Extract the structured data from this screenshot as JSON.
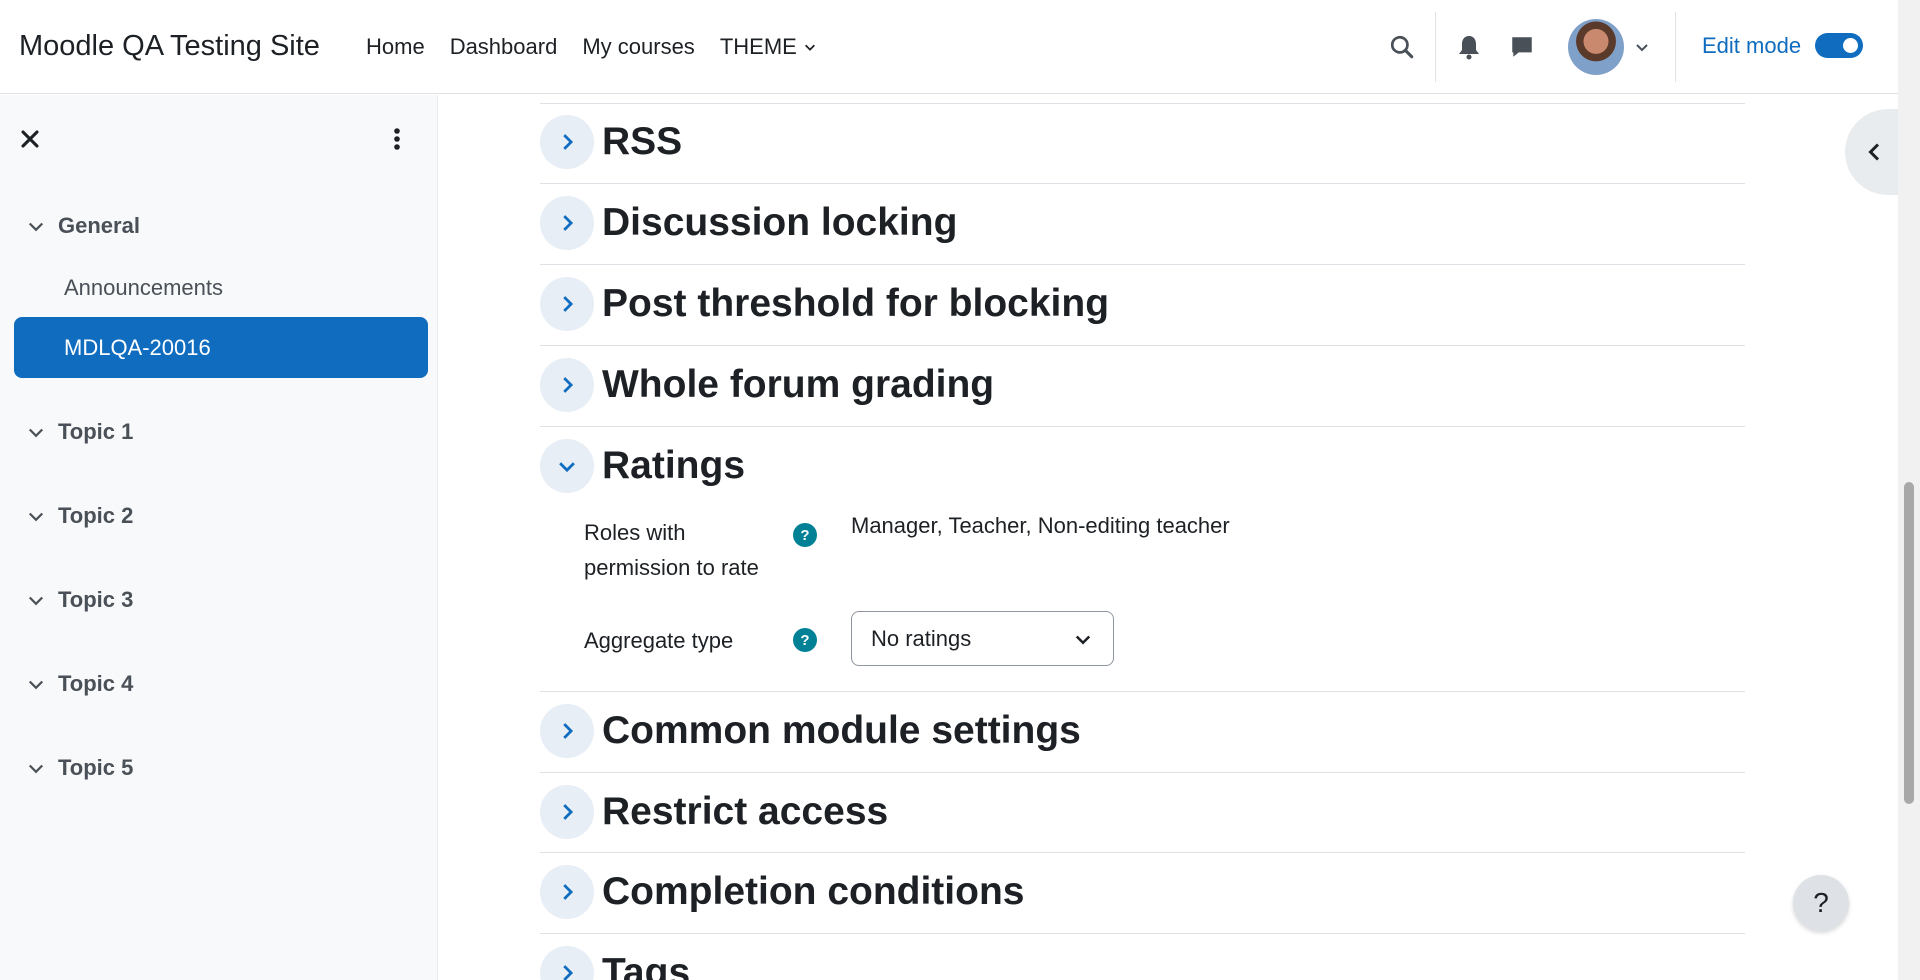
{
  "navbar": {
    "site_name": "Moodle QA Testing Site",
    "links": [
      "Home",
      "Dashboard",
      "My courses",
      "THEME"
    ],
    "edit_mode_label": "Edit mode",
    "edit_mode_on": true
  },
  "drawer": {
    "sections": [
      {
        "label": "General",
        "activities": [
          "Announcements",
          "MDLQA-20016"
        ],
        "active_activity": "MDLQA-20016"
      },
      {
        "label": "Topic 1"
      },
      {
        "label": "Topic 2"
      },
      {
        "label": "Topic 3"
      },
      {
        "label": "Topic 4"
      },
      {
        "label": "Topic 5"
      }
    ]
  },
  "main": {
    "collapsed_before": [
      "RSS",
      "Discussion locking",
      "Post threshold for blocking",
      "Whole forum grading"
    ],
    "expanded_section": {
      "title": "Ratings",
      "fields": {
        "roles_label": "Roles with permission to rate",
        "roles_value": "Manager, Teacher, Non-editing teacher",
        "aggregate_label": "Aggregate type",
        "aggregate_value": "No ratings"
      }
    },
    "collapsed_after": [
      "Common module settings",
      "Restrict access",
      "Completion conditions",
      "Tags"
    ]
  },
  "help_button": "?",
  "help_icon": "?",
  "colors": {
    "brand": "#0f6cbf",
    "help_icon": "#008196"
  }
}
